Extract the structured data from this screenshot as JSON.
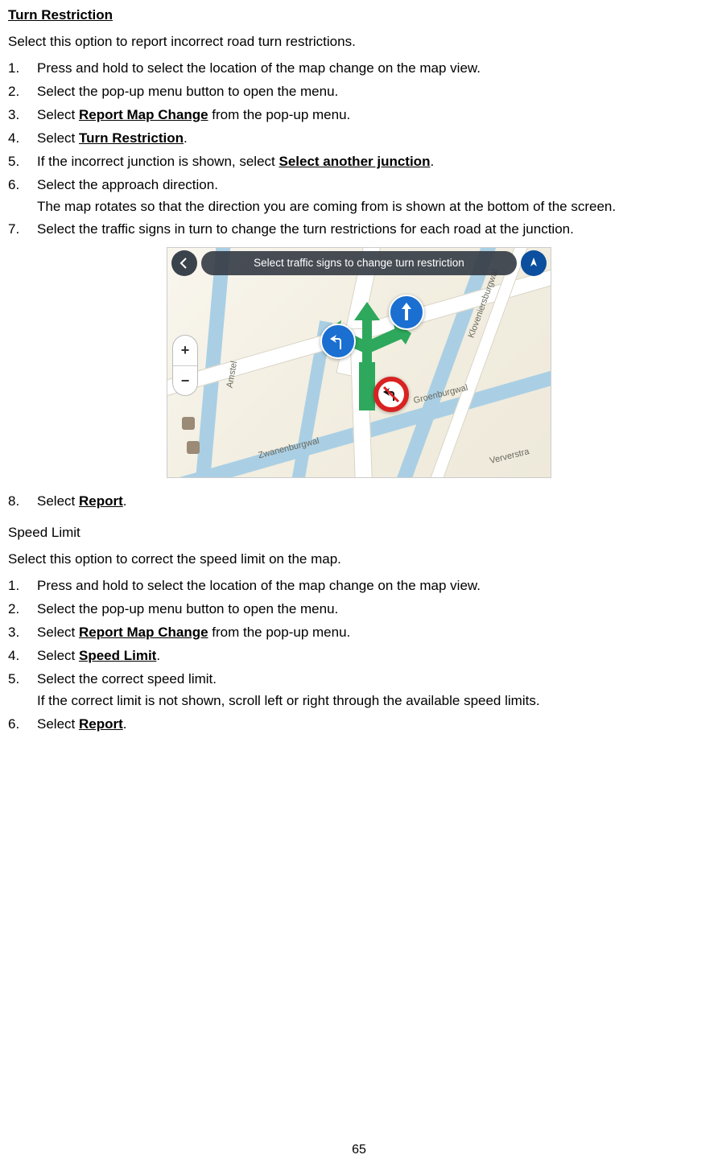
{
  "section1": {
    "title": "Turn Restriction",
    "intro": "Select this option to report incorrect road turn restrictions.",
    "steps": [
      {
        "n": "1.",
        "pre": "Press and hold to select the location of the map change on the map view."
      },
      {
        "n": "2.",
        "pre": "Select the pop-up menu button to open the menu."
      },
      {
        "n": "3.",
        "pre": "Select ",
        "bold": "Report Map Change",
        "post": " from the pop-up menu."
      },
      {
        "n": "4.",
        "pre": "Select ",
        "bold": "Turn Restriction",
        "post": "."
      },
      {
        "n": "5.",
        "pre": "If the incorrect junction is shown, select ",
        "bold": "Select another junction",
        "post": "."
      },
      {
        "n": "6.",
        "pre": "Select the approach direction.",
        "sub": "The map rotates so that the direction you are coming from is shown at the bottom of the screen."
      },
      {
        "n": "7.",
        "pre": "Select the traffic signs in turn to change the turn restrictions for each road at the junction."
      }
    ],
    "steps_after_image": [
      {
        "n": "8.",
        "pre": "Select ",
        "bold": "Report",
        "post": "."
      }
    ]
  },
  "map": {
    "topbar": "Select traffic signs to change turn restriction",
    "zoom_in": "+",
    "zoom_out": "−",
    "labels": {
      "amstel": "Amstel",
      "kloveniers": "Kloveniersburgwal",
      "groen": "Groenburgwal",
      "zwanen": "Zwanenburgwal",
      "ververs": "Ververstra"
    }
  },
  "section2": {
    "title": "Speed Limit",
    "intro": "Select this option to correct the speed limit on the map.",
    "steps": [
      {
        "n": "1.",
        "pre": "Press and hold to select the location of the map change on the map view."
      },
      {
        "n": "2.",
        "pre": "Select the pop-up menu button to open the menu."
      },
      {
        "n": "3.",
        "pre": "Select ",
        "bold": "Report Map Change",
        "post": " from the pop-up menu."
      },
      {
        "n": "4.",
        "pre": "Select ",
        "bold": "Speed Limit",
        "post": "."
      },
      {
        "n": "5.",
        "pre": "Select the correct speed limit.",
        "sub": "If the correct limit is not shown, scroll left or right through the available speed limits."
      },
      {
        "n": "6.",
        "pre": "Select ",
        "bold": "Report",
        "post": "."
      }
    ]
  },
  "page_number": "65"
}
